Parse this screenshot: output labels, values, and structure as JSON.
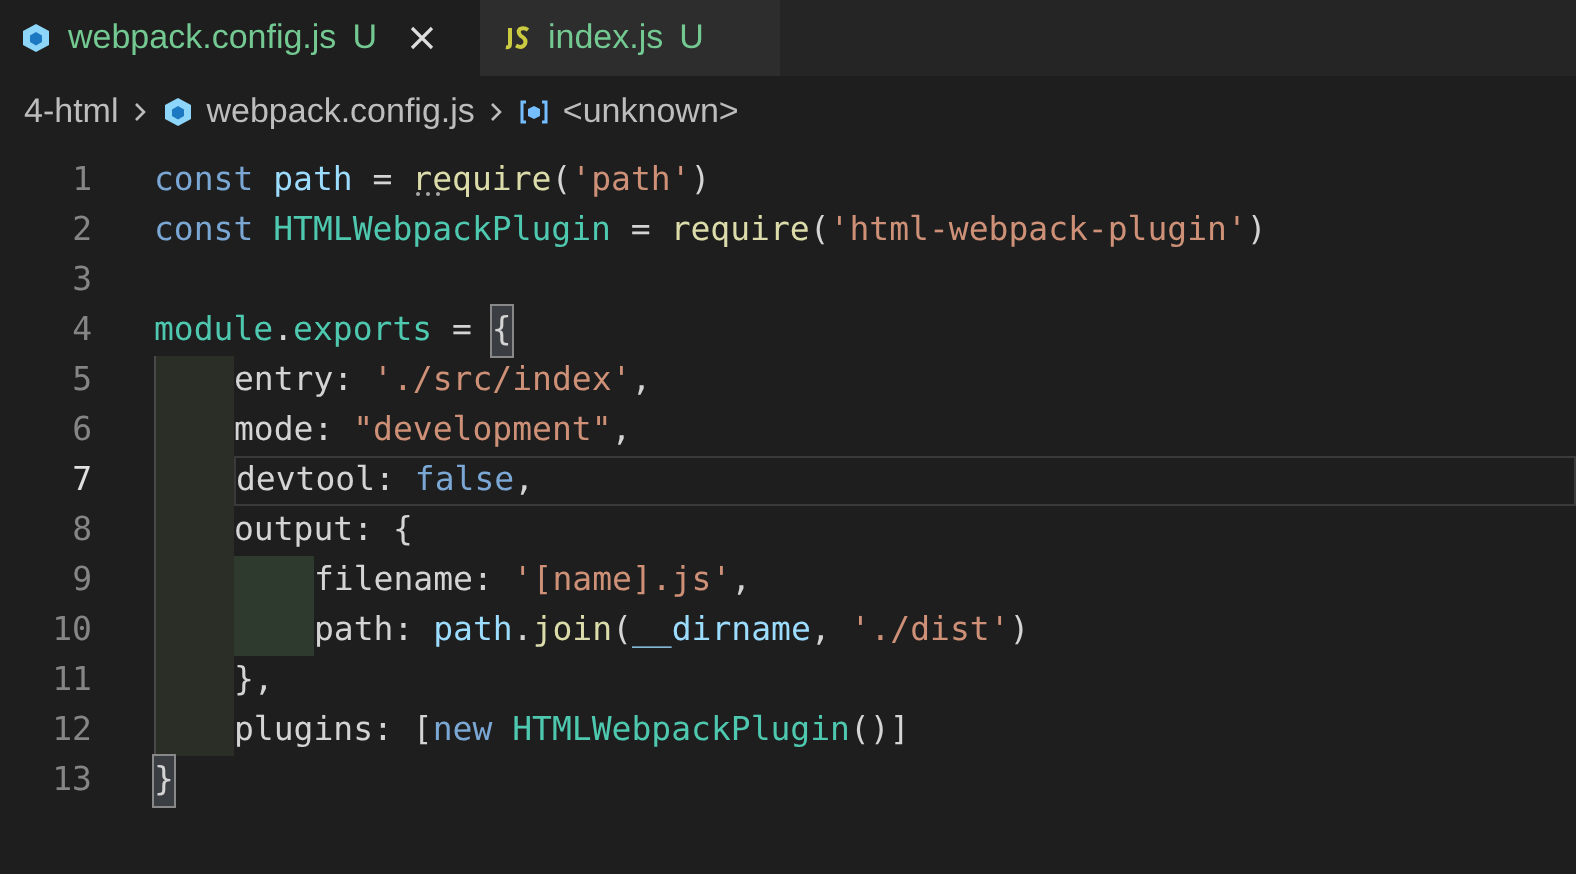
{
  "tabs": [
    {
      "label": "webpack.config.js",
      "status": "U",
      "kind": "config",
      "selected": true
    },
    {
      "label": "index.js",
      "status": "U",
      "kind": "script",
      "selected": false
    }
  ],
  "breadcrumbs": [
    {
      "label": "4-html",
      "kind": "folder"
    },
    {
      "label": "webpack.config.js",
      "kind": "config"
    },
    {
      "label": "<unknown>",
      "kind": "symbol"
    }
  ],
  "lines": [
    {
      "number": "1",
      "tokens": [
        {
          "kind": "keyword",
          "text": "const "
        },
        {
          "kind": "variable",
          "text": "path"
        },
        {
          "kind": "plain",
          "text": " = "
        },
        {
          "kind": "function",
          "text": "require",
          "hint": true
        },
        {
          "kind": "plain",
          "text": "("
        },
        {
          "kind": "string",
          "text": "'path'"
        },
        {
          "kind": "plain",
          "text": ")"
        }
      ]
    },
    {
      "number": "2",
      "tokens": [
        {
          "kind": "keyword",
          "text": "const "
        },
        {
          "kind": "class",
          "text": "HTMLWebpackPlugin"
        },
        {
          "kind": "plain",
          "text": " = "
        },
        {
          "kind": "function",
          "text": "require"
        },
        {
          "kind": "plain",
          "text": "("
        },
        {
          "kind": "string",
          "text": "'html-webpack-plugin'"
        },
        {
          "kind": "plain",
          "text": ")"
        }
      ]
    },
    {
      "number": "3"
    },
    {
      "number": "4",
      "tokens": [
        {
          "kind": "class",
          "text": "module"
        },
        {
          "kind": "plain",
          "text": "."
        },
        {
          "kind": "class",
          "text": "exports"
        },
        {
          "kind": "plain",
          "text": " = "
        },
        {
          "kind": "bracket-match",
          "text": "{"
        }
      ],
      "children": [
        {
          "number": "5",
          "tokens": [
            {
              "kind": "property",
              "text": "entry"
            },
            {
              "kind": "plain",
              "text": ": "
            },
            {
              "kind": "string",
              "text": "'./src/index'"
            },
            {
              "kind": "plain",
              "text": ","
            }
          ]
        },
        {
          "number": "6",
          "tokens": [
            {
              "kind": "property",
              "text": "mode"
            },
            {
              "kind": "plain",
              "text": ": "
            },
            {
              "kind": "string",
              "text": "\"development\""
            },
            {
              "kind": "plain",
              "text": ","
            }
          ]
        },
        {
          "number": "7",
          "current": true,
          "tokens": [
            {
              "kind": "property",
              "text": "devtool"
            },
            {
              "kind": "plain",
              "text": ": "
            },
            {
              "kind": "keyword",
              "text": "false"
            },
            {
              "kind": "plain",
              "text": ","
            }
          ]
        },
        {
          "number": "8",
          "tokens": [
            {
              "kind": "property",
              "text": "output"
            },
            {
              "kind": "plain",
              "text": ": {"
            }
          ],
          "children": [
            {
              "number": "9",
              "tokens": [
                {
                  "kind": "property",
                  "text": "filename"
                },
                {
                  "kind": "plain",
                  "text": ": "
                },
                {
                  "kind": "string",
                  "text": "'[name].js'"
                },
                {
                  "kind": "plain",
                  "text": ","
                }
              ]
            },
            {
              "number": "10",
              "tokens": [
                {
                  "kind": "property",
                  "text": "path"
                },
                {
                  "kind": "plain",
                  "text": ": "
                },
                {
                  "kind": "variable",
                  "text": "path"
                },
                {
                  "kind": "plain",
                  "text": "."
                },
                {
                  "kind": "function",
                  "text": "join"
                },
                {
                  "kind": "plain",
                  "text": "("
                },
                {
                  "kind": "variable",
                  "text": "__dirname"
                },
                {
                  "kind": "plain",
                  "text": ", "
                },
                {
                  "kind": "string",
                  "text": "'./dist'"
                },
                {
                  "kind": "plain",
                  "text": ")"
                }
              ]
            }
          ]
        },
        {
          "number": "11",
          "tokens": [
            {
              "kind": "plain",
              "text": "},"
            }
          ]
        },
        {
          "number": "12",
          "tokens": [
            {
              "kind": "property",
              "text": "plugins"
            },
            {
              "kind": "plain",
              "text": ": ["
            },
            {
              "kind": "keyword",
              "text": "new "
            },
            {
              "kind": "class",
              "text": "HTMLWebpackPlugin"
            },
            {
              "kind": "plain",
              "text": "()]"
            }
          ]
        }
      ]
    },
    {
      "number": "13",
      "tokens": [
        {
          "kind": "bracket-match",
          "text": "}"
        }
      ]
    }
  ]
}
